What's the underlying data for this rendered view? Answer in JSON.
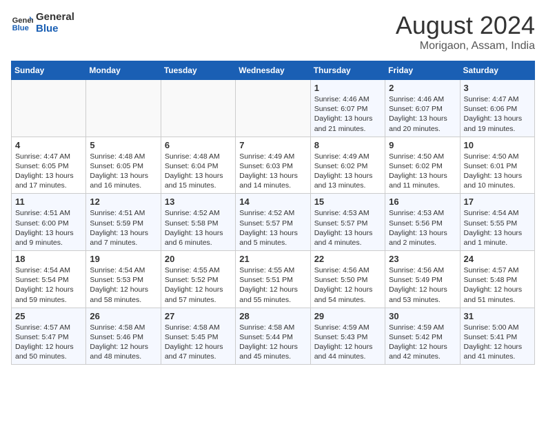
{
  "header": {
    "logo_line1": "General",
    "logo_line2": "Blue",
    "month": "August 2024",
    "location": "Morigaon, Assam, India"
  },
  "days_of_week": [
    "Sunday",
    "Monday",
    "Tuesday",
    "Wednesday",
    "Thursday",
    "Friday",
    "Saturday"
  ],
  "weeks": [
    [
      {
        "day": "",
        "info": ""
      },
      {
        "day": "",
        "info": ""
      },
      {
        "day": "",
        "info": ""
      },
      {
        "day": "",
        "info": ""
      },
      {
        "day": "1",
        "info": "Sunrise: 4:46 AM\nSunset: 6:07 PM\nDaylight: 13 hours\nand 21 minutes."
      },
      {
        "day": "2",
        "info": "Sunrise: 4:46 AM\nSunset: 6:07 PM\nDaylight: 13 hours\nand 20 minutes."
      },
      {
        "day": "3",
        "info": "Sunrise: 4:47 AM\nSunset: 6:06 PM\nDaylight: 13 hours\nand 19 minutes."
      }
    ],
    [
      {
        "day": "4",
        "info": "Sunrise: 4:47 AM\nSunset: 6:05 PM\nDaylight: 13 hours\nand 17 minutes."
      },
      {
        "day": "5",
        "info": "Sunrise: 4:48 AM\nSunset: 6:05 PM\nDaylight: 13 hours\nand 16 minutes."
      },
      {
        "day": "6",
        "info": "Sunrise: 4:48 AM\nSunset: 6:04 PM\nDaylight: 13 hours\nand 15 minutes."
      },
      {
        "day": "7",
        "info": "Sunrise: 4:49 AM\nSunset: 6:03 PM\nDaylight: 13 hours\nand 14 minutes."
      },
      {
        "day": "8",
        "info": "Sunrise: 4:49 AM\nSunset: 6:02 PM\nDaylight: 13 hours\nand 13 minutes."
      },
      {
        "day": "9",
        "info": "Sunrise: 4:50 AM\nSunset: 6:02 PM\nDaylight: 13 hours\nand 11 minutes."
      },
      {
        "day": "10",
        "info": "Sunrise: 4:50 AM\nSunset: 6:01 PM\nDaylight: 13 hours\nand 10 minutes."
      }
    ],
    [
      {
        "day": "11",
        "info": "Sunrise: 4:51 AM\nSunset: 6:00 PM\nDaylight: 13 hours\nand 9 minutes."
      },
      {
        "day": "12",
        "info": "Sunrise: 4:51 AM\nSunset: 5:59 PM\nDaylight: 13 hours\nand 7 minutes."
      },
      {
        "day": "13",
        "info": "Sunrise: 4:52 AM\nSunset: 5:58 PM\nDaylight: 13 hours\nand 6 minutes."
      },
      {
        "day": "14",
        "info": "Sunrise: 4:52 AM\nSunset: 5:57 PM\nDaylight: 13 hours\nand 5 minutes."
      },
      {
        "day": "15",
        "info": "Sunrise: 4:53 AM\nSunset: 5:57 PM\nDaylight: 13 hours\nand 4 minutes."
      },
      {
        "day": "16",
        "info": "Sunrise: 4:53 AM\nSunset: 5:56 PM\nDaylight: 13 hours\nand 2 minutes."
      },
      {
        "day": "17",
        "info": "Sunrise: 4:54 AM\nSunset: 5:55 PM\nDaylight: 13 hours\nand 1 minute."
      }
    ],
    [
      {
        "day": "18",
        "info": "Sunrise: 4:54 AM\nSunset: 5:54 PM\nDaylight: 12 hours\nand 59 minutes."
      },
      {
        "day": "19",
        "info": "Sunrise: 4:54 AM\nSunset: 5:53 PM\nDaylight: 12 hours\nand 58 minutes."
      },
      {
        "day": "20",
        "info": "Sunrise: 4:55 AM\nSunset: 5:52 PM\nDaylight: 12 hours\nand 57 minutes."
      },
      {
        "day": "21",
        "info": "Sunrise: 4:55 AM\nSunset: 5:51 PM\nDaylight: 12 hours\nand 55 minutes."
      },
      {
        "day": "22",
        "info": "Sunrise: 4:56 AM\nSunset: 5:50 PM\nDaylight: 12 hours\nand 54 minutes."
      },
      {
        "day": "23",
        "info": "Sunrise: 4:56 AM\nSunset: 5:49 PM\nDaylight: 12 hours\nand 53 minutes."
      },
      {
        "day": "24",
        "info": "Sunrise: 4:57 AM\nSunset: 5:48 PM\nDaylight: 12 hours\nand 51 minutes."
      }
    ],
    [
      {
        "day": "25",
        "info": "Sunrise: 4:57 AM\nSunset: 5:47 PM\nDaylight: 12 hours\nand 50 minutes."
      },
      {
        "day": "26",
        "info": "Sunrise: 4:58 AM\nSunset: 5:46 PM\nDaylight: 12 hours\nand 48 minutes."
      },
      {
        "day": "27",
        "info": "Sunrise: 4:58 AM\nSunset: 5:45 PM\nDaylight: 12 hours\nand 47 minutes."
      },
      {
        "day": "28",
        "info": "Sunrise: 4:58 AM\nSunset: 5:44 PM\nDaylight: 12 hours\nand 45 minutes."
      },
      {
        "day": "29",
        "info": "Sunrise: 4:59 AM\nSunset: 5:43 PM\nDaylight: 12 hours\nand 44 minutes."
      },
      {
        "day": "30",
        "info": "Sunrise: 4:59 AM\nSunset: 5:42 PM\nDaylight: 12 hours\nand 42 minutes."
      },
      {
        "day": "31",
        "info": "Sunrise: 5:00 AM\nSunset: 5:41 PM\nDaylight: 12 hours\nand 41 minutes."
      }
    ]
  ]
}
